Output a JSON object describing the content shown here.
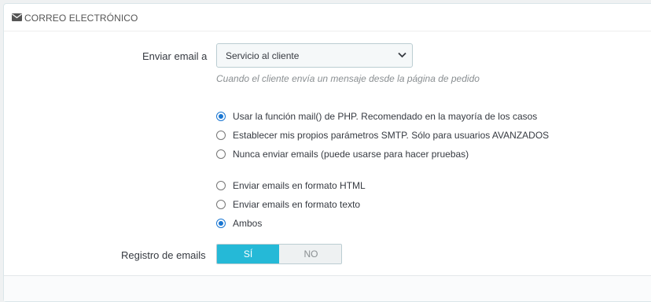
{
  "panel": {
    "heading": "CORREO ELECTRÓNICO",
    "heading_icon": "envelope-icon"
  },
  "send_to": {
    "label": "Enviar email a",
    "selected": "Servicio al cliente",
    "help": "Cuando el cliente envía un mensaje desde la página de pedido"
  },
  "mail_method": {
    "options": [
      {
        "label": "Usar la función mail() de PHP. Recomendado en la mayoría de los casos",
        "checked": true
      },
      {
        "label": "Establecer mis propios parámetros SMTP. Sólo para usuarios AVANZADOS",
        "checked": false
      },
      {
        "label": "Nunca enviar emails (puede usarse para hacer pruebas)",
        "checked": false
      }
    ]
  },
  "mail_format": {
    "options": [
      {
        "label": "Enviar emails en formato HTML",
        "checked": false
      },
      {
        "label": "Enviar emails en formato texto",
        "checked": false
      },
      {
        "label": "Ambos",
        "checked": true
      }
    ]
  },
  "log_emails": {
    "label": "Registro de emails",
    "yes": "SÍ",
    "no": "NO",
    "value": "yes"
  },
  "colors": {
    "accent": "#25b9d7",
    "radio_checked": "#1976d2"
  }
}
